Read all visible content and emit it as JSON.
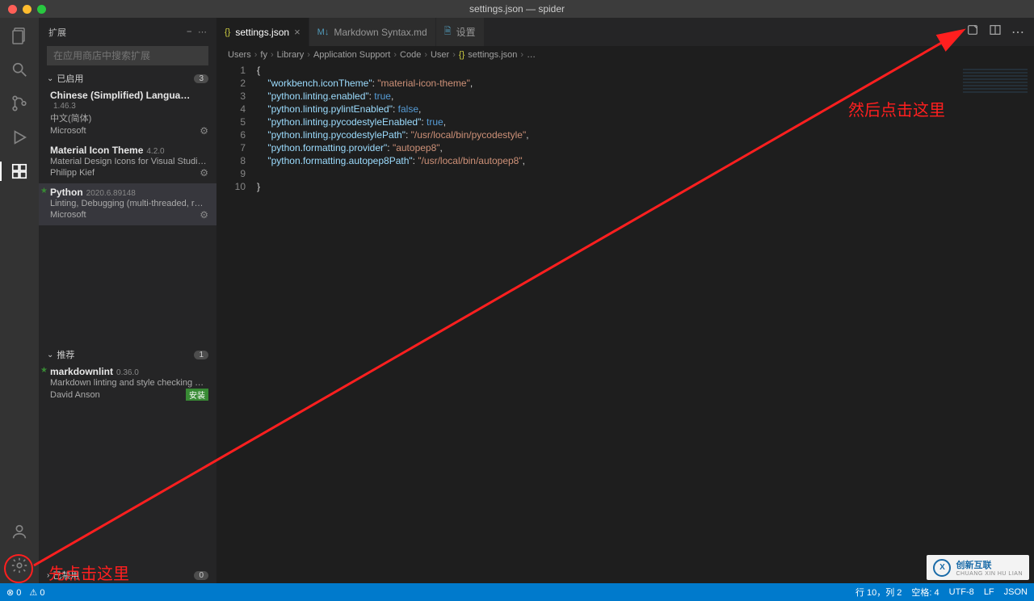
{
  "window": {
    "title": "settings.json — spider"
  },
  "sidebar": {
    "title": "扩展",
    "search_placeholder": "在应用商店中搜索扩展",
    "enabled_label": "已启用",
    "enabled_count": "3",
    "recommended_label": "推荐",
    "recommended_count": "1",
    "disabled_label": "已禁用",
    "disabled_count": "0",
    "install_label": "安装",
    "extensions": [
      {
        "name": "Chinese (Simplified) Langua…",
        "version": "1.46.3",
        "desc": "中文(简体)",
        "publisher": "Microsoft"
      },
      {
        "name": "Material Icon Theme",
        "version": "4.2.0",
        "desc": "Material Design Icons for Visual Studi…",
        "publisher": "Philipp Kief"
      },
      {
        "name": "Python",
        "version": "2020.6.89148",
        "desc": "Linting, Debugging (multi-threaded, r…",
        "publisher": "Microsoft"
      }
    ],
    "recommended": [
      {
        "name": "markdownlint",
        "version": "0.36.0",
        "desc": "Markdown linting and style checking …",
        "publisher": "David Anson"
      }
    ]
  },
  "tabs": [
    {
      "label": "settings.json",
      "icon": "{}",
      "active": true,
      "close": true
    },
    {
      "label": "Markdown Syntax.md",
      "icon": "M↓",
      "active": false
    },
    {
      "label": "设置",
      "icon": "🗎",
      "active": false
    }
  ],
  "breadcrumb": [
    "Users",
    "fy",
    "Library",
    "Application Support",
    "Code",
    "User",
    "settings.json",
    "…"
  ],
  "code": {
    "lines": [
      [
        {
          "t": "brace",
          "v": "{"
        }
      ],
      [
        {
          "t": "ind",
          "v": "    "
        },
        {
          "t": "key",
          "v": "\"workbench.iconTheme\""
        },
        {
          "t": "punc",
          "v": ": "
        },
        {
          "t": "str",
          "v": "\"material-icon-theme\""
        },
        {
          "t": "punc",
          "v": ","
        }
      ],
      [
        {
          "t": "ind",
          "v": "    "
        },
        {
          "t": "key",
          "v": "\"python.linting.enabled\""
        },
        {
          "t": "punc",
          "v": ": "
        },
        {
          "t": "bool",
          "v": "true"
        },
        {
          "t": "punc",
          "v": ","
        }
      ],
      [
        {
          "t": "ind",
          "v": "    "
        },
        {
          "t": "key",
          "v": "\"python.linting.pylintEnabled\""
        },
        {
          "t": "punc",
          "v": ": "
        },
        {
          "t": "bool",
          "v": "false"
        },
        {
          "t": "punc",
          "v": ","
        }
      ],
      [
        {
          "t": "ind",
          "v": "    "
        },
        {
          "t": "key",
          "v": "\"python.linting.pycodestyleEnabled\""
        },
        {
          "t": "punc",
          "v": ": "
        },
        {
          "t": "bool",
          "v": "true"
        },
        {
          "t": "punc",
          "v": ","
        }
      ],
      [
        {
          "t": "ind",
          "v": "    "
        },
        {
          "t": "key",
          "v": "\"python.linting.pycodestylePath\""
        },
        {
          "t": "punc",
          "v": ": "
        },
        {
          "t": "str",
          "v": "\"/usr/local/bin/pycodestyle\""
        },
        {
          "t": "punc",
          "v": ","
        }
      ],
      [
        {
          "t": "ind",
          "v": "    "
        },
        {
          "t": "key",
          "v": "\"python.formatting.provider\""
        },
        {
          "t": "punc",
          "v": ": "
        },
        {
          "t": "str",
          "v": "\"autopep8\""
        },
        {
          "t": "punc",
          "v": ","
        }
      ],
      [
        {
          "t": "ind",
          "v": "    "
        },
        {
          "t": "key",
          "v": "\"python.formatting.autopep8Path\""
        },
        {
          "t": "punc",
          "v": ": "
        },
        {
          "t": "str",
          "v": "\"/usr/local/bin/autopep8\""
        },
        {
          "t": "punc",
          "v": ","
        }
      ],
      [],
      [
        {
          "t": "brace",
          "v": "}"
        }
      ]
    ]
  },
  "status": {
    "errors": "0",
    "warnings": "0",
    "line_col": "行 10，列 2",
    "spaces": "空格: 4",
    "encoding": "UTF-8",
    "eol": "LF",
    "lang": "JSON"
  },
  "annotations": {
    "bottom": "先点击这里",
    "top": "然后点击这里"
  },
  "watermark": {
    "main": "创新互联",
    "sub": "CHUANG XIN HU LIAN"
  }
}
